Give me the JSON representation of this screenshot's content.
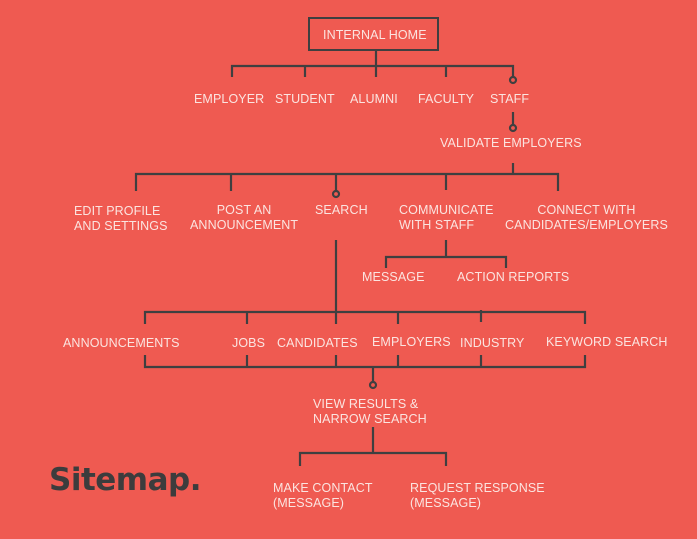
{
  "title": "Sitemap.",
  "colors": {
    "background": "#ef5a51",
    "line": "#3f3f40",
    "text": "#fbe4e0",
    "title": "#3c3c3d"
  },
  "nodes": {
    "internal_home": "INTERNAL HOME",
    "employer": "EMPLOYER",
    "student": "STUDENT",
    "alumni": "ALUMNI",
    "faculty": "FACULTY",
    "staff": "STAFF",
    "validate_employers": "VALIDATE EMPLOYERS",
    "edit_profile": "EDIT PROFILE\nAND SETTINGS",
    "post_announcement": "POST AN\nANNOUNCEMENT",
    "search": "SEARCH",
    "communicate_staff": "COMMUNICATE\nWITH STAFF",
    "connect_with": "CONNECT WITH\nCANDIDATES/EMPLOYERS",
    "message": "MESSAGE",
    "action_reports": "ACTION REPORTS",
    "announcements": "ANNOUNCEMENTS",
    "jobs": "JOBS",
    "candidates": "CANDIDATES",
    "employers": "EMPLOYERS",
    "industry": "INDUSTRY",
    "keyword_search": "KEYWORD SEARCH",
    "view_results": "VIEW RESULTS &\nNARROW SEARCH",
    "make_contact": "MAKE CONTACT\n(MESSAGE)",
    "request_response": "REQUEST RESPONSE\n(MESSAGE)"
  }
}
